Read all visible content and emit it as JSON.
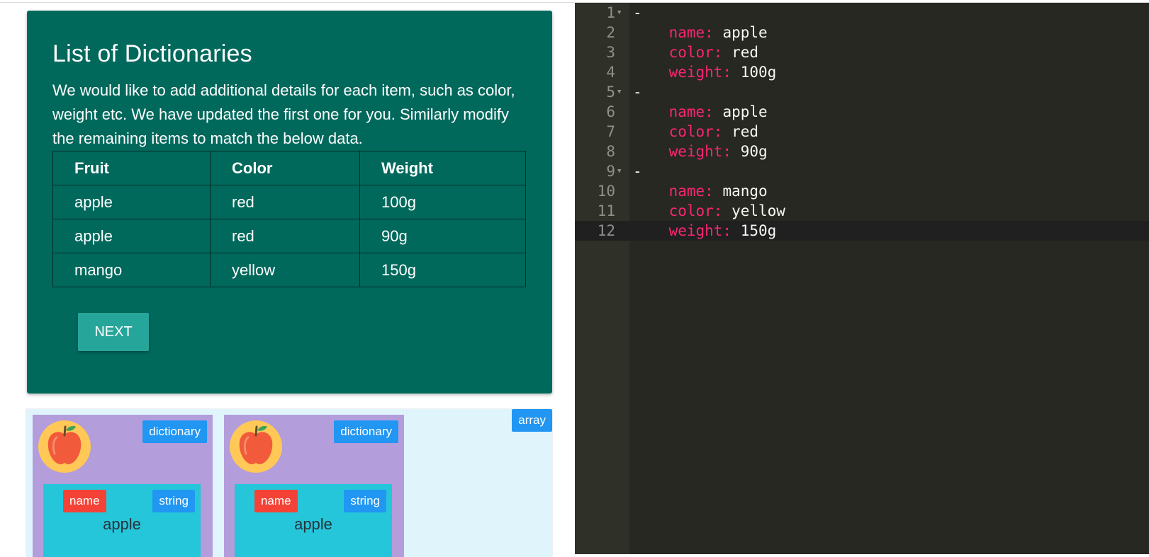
{
  "lesson": {
    "title": "List of Dictionaries",
    "description": "We would like to add additional details for each item, such as color, weight etc. We have updated the first one for you. Similarly modify the remaining items to match the below data.",
    "table": {
      "headers": [
        "Fruit",
        "Color",
        "Weight"
      ],
      "rows": [
        [
          "apple",
          "red",
          "100g"
        ],
        [
          "apple",
          "red",
          "90g"
        ],
        [
          "mango",
          "yellow",
          "150g"
        ]
      ]
    },
    "next_label": "NEXT"
  },
  "visual": {
    "array_label": "array",
    "items": [
      {
        "type_label": "dictionary",
        "icon": "apple-icon",
        "key_label": "name",
        "value_type": "string",
        "value": "apple"
      },
      {
        "type_label": "dictionary",
        "icon": "apple-icon",
        "key_label": "name",
        "value_type": "string",
        "value": "apple"
      }
    ]
  },
  "editor": {
    "lines": [
      {
        "num": "1",
        "fold": true,
        "dash": "-"
      },
      {
        "num": "2",
        "key": "name:",
        "value": "apple"
      },
      {
        "num": "3",
        "key": "color:",
        "value": "red"
      },
      {
        "num": "4",
        "key": "weight:",
        "value": "100g"
      },
      {
        "num": "5",
        "fold": true,
        "dash": "-"
      },
      {
        "num": "6",
        "key": "name:",
        "value": "apple"
      },
      {
        "num": "7",
        "key": "color:",
        "value": "red"
      },
      {
        "num": "8",
        "key": "weight:",
        "value": "90g"
      },
      {
        "num": "9",
        "fold": true,
        "dash": "-"
      },
      {
        "num": "10",
        "key": "name:",
        "value": "mango"
      },
      {
        "num": "11",
        "key": "color:",
        "value": "yellow"
      },
      {
        "num": "12",
        "key": "weight:",
        "value": "150g",
        "active": true
      }
    ]
  },
  "colors": {
    "card_bg": "#00695c",
    "button_bg": "#26a69a",
    "dictionary_bg": "#b39ddb",
    "pair_bg": "#26c6da",
    "tag_blue": "#2196f3",
    "tag_red": "#f44336",
    "editor_bg": "#272822",
    "editor_key": "#f92672"
  }
}
